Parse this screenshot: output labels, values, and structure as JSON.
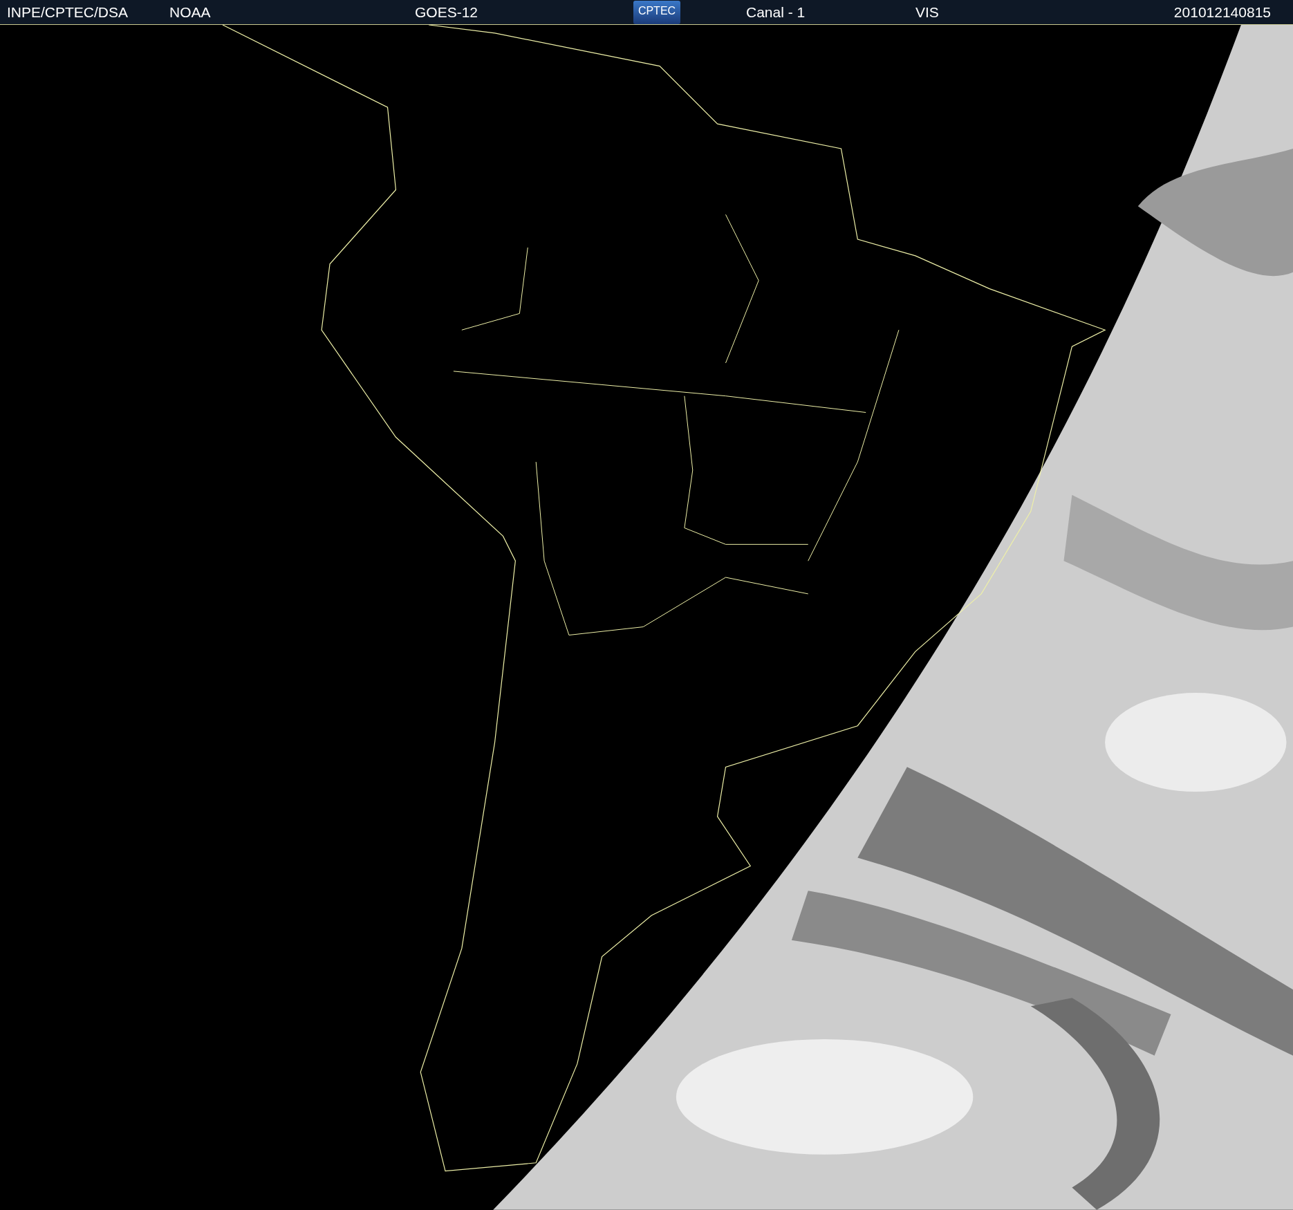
{
  "header": {
    "source": "INPE/CPTEC/DSA",
    "agency": "NOAA",
    "satellite": "GOES-12",
    "logo": "CPTEC",
    "channel": "Canal - 1",
    "band": "VIS",
    "timestamp": "201012140815"
  }
}
